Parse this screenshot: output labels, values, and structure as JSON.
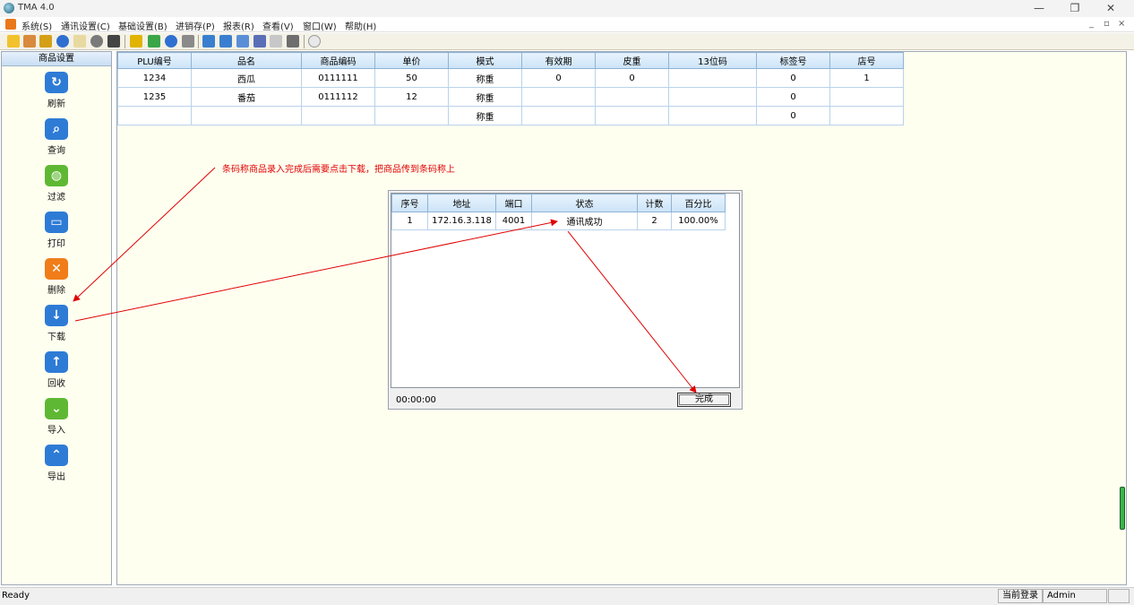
{
  "window": {
    "title": "TMA 4.0",
    "minimize": "—",
    "restore": "❐",
    "close": "✕"
  },
  "menu": [
    {
      "label": "系统(S)"
    },
    {
      "label": "通讯设置(C)"
    },
    {
      "label": "基础设置(B)"
    },
    {
      "label": "进销存(P)"
    },
    {
      "label": "报表(R)"
    },
    {
      "label": "查看(V)"
    },
    {
      "label": "窗口(W)"
    },
    {
      "label": "帮助(H)"
    }
  ],
  "mdi_controls": {
    "minimize": "_",
    "restore": "▫",
    "close": "×"
  },
  "sidebar": {
    "title": "商品设置",
    "items": [
      {
        "label": "刷新",
        "glyph": "↻",
        "icon": "refresh-icon",
        "color": "#2e7bd6"
      },
      {
        "label": "查询",
        "glyph": "⌕",
        "icon": "search-icon",
        "color": "#2e7bd6"
      },
      {
        "label": "过滤",
        "glyph": "◍",
        "icon": "globe-icon",
        "color": "#5fb833"
      },
      {
        "label": "打印",
        "glyph": "▭",
        "icon": "camera-icon",
        "color": "#2e7bd6"
      },
      {
        "label": "删除",
        "glyph": "✕",
        "icon": "delete-icon",
        "color": "#f07d1a"
      },
      {
        "label": "下载",
        "glyph": "↓",
        "icon": "download-icon",
        "color": "#2e7bd6"
      },
      {
        "label": "回收",
        "glyph": "↑",
        "icon": "upload-icon",
        "color": "#2e7bd6"
      },
      {
        "label": "导入",
        "glyph": "⌄",
        "icon": "import-icon",
        "color": "#5fb833"
      },
      {
        "label": "导出",
        "glyph": "⌃",
        "icon": "export-icon",
        "color": "#2e7bd6"
      }
    ]
  },
  "grid": {
    "columns": [
      "PLU编号",
      "品名",
      "商品编码",
      "单价",
      "模式",
      "有效期",
      "皮重",
      "13位码",
      "标签号",
      "店号"
    ],
    "rows": [
      [
        "1234",
        "西瓜",
        "0111111",
        "50",
        "称重",
        "0",
        "0",
        "",
        "0",
        "1"
      ],
      [
        "1235",
        "番茄",
        "0111112",
        "12",
        "称重",
        "",
        "",
        "",
        "0",
        ""
      ],
      [
        "",
        "",
        "",
        "",
        "称重",
        "",
        "",
        "",
        "0",
        ""
      ]
    ]
  },
  "annotation": "条码称商品录入完成后需要点击下载，把商品传到条码称上",
  "dialog": {
    "columns": [
      "序号",
      "地址",
      "端口",
      "状态",
      "计数",
      "百分比"
    ],
    "rows": [
      [
        "1",
        "172.16.3.118",
        "4001",
        "通讯成功",
        "2",
        "100.00%"
      ]
    ],
    "timer": "00:00:00",
    "done_label": "完成"
  },
  "status": {
    "ready": "Ready",
    "login_label": "当前登录",
    "user": "Admin"
  },
  "colors": {
    "accent_red": "#e00000",
    "panel_bg": "#fffff0",
    "header_blue": "#cbe3f7"
  }
}
